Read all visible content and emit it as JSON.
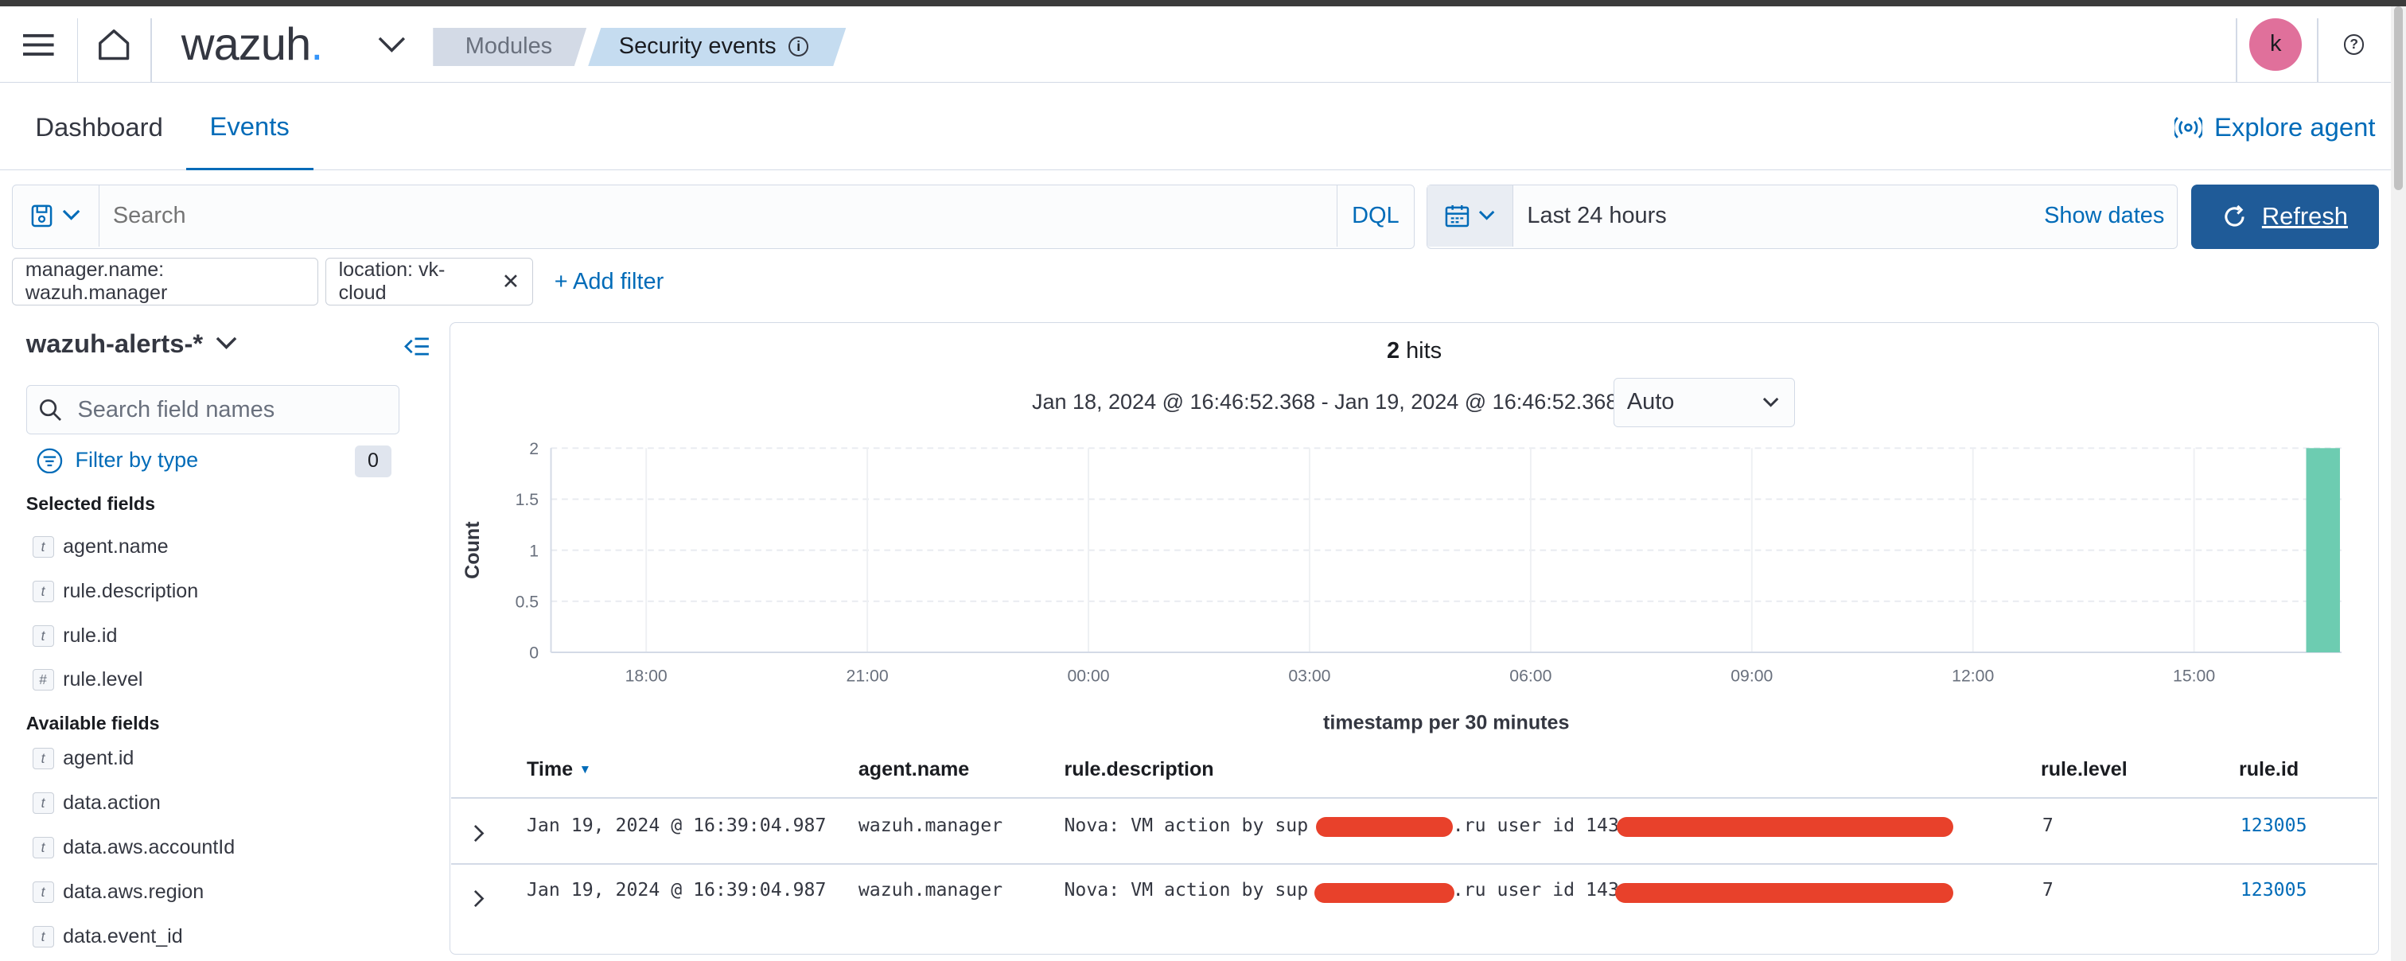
{
  "header": {
    "logo": "wazuh",
    "logo_dot": ".",
    "breadcrumbs": [
      "Modules",
      "Security events"
    ],
    "avatar_letter": "k",
    "icons": [
      "menu-icon",
      "home-icon",
      "chevron-down-icon",
      "info-icon",
      "help-icon"
    ]
  },
  "tabs": {
    "items": [
      "Dashboard",
      "Events"
    ],
    "active": "Events",
    "explore_agent": "Explore agent"
  },
  "query": {
    "search_placeholder": "Search",
    "dql": "DQL",
    "time_range": "Last 24 hours",
    "show_dates": "Show dates",
    "refresh": "Refresh"
  },
  "filters": {
    "pills": [
      "manager.name: wazuh.manager",
      "location: vk-cloud"
    ],
    "add_filter": "+ Add filter"
  },
  "sidebar": {
    "index_pattern": "wazuh-alerts-*",
    "search_placeholder": "Search field names",
    "filter_by_type": "Filter by type",
    "filter_count": "0",
    "selected_title": "Selected fields",
    "selected_fields": [
      {
        "type": "t",
        "name": "agent.name"
      },
      {
        "type": "t",
        "name": "rule.description"
      },
      {
        "type": "t",
        "name": "rule.id"
      },
      {
        "type": "#",
        "name": "rule.level"
      }
    ],
    "available_title": "Available fields",
    "available_fields": [
      {
        "type": "t",
        "name": "agent.id"
      },
      {
        "type": "t",
        "name": "data.action"
      },
      {
        "type": "t",
        "name": "data.aws.accountId"
      },
      {
        "type": "t",
        "name": "data.aws.region"
      },
      {
        "type": "t",
        "name": "data.event_id"
      }
    ]
  },
  "histogram": {
    "hits_count": "2",
    "hits_label": "hits",
    "range": "Jan 18, 2024 @ 16:46:52.368 - Jan 19, 2024 @ 16:46:52.368",
    "interval": "Auto"
  },
  "chart_data": {
    "type": "bar",
    "ylabel": "Count",
    "xlabel": "timestamp per 30 minutes",
    "yticks": [
      "2",
      "1.5",
      "1",
      "0.5",
      "0"
    ],
    "xticks": [
      "18:00",
      "21:00",
      "00:00",
      "03:00",
      "06:00",
      "09:00",
      "12:00",
      "15:00"
    ],
    "ylim": [
      0,
      2
    ],
    "x": [
      "16:30"
    ],
    "values": [
      2
    ],
    "bar_color": "#6dccb1"
  },
  "table": {
    "columns": [
      "Time",
      "agent.name",
      "rule.description",
      "rule.level",
      "rule.id"
    ],
    "rows": [
      {
        "time": "Jan 19, 2024 @ 16:39:04.987",
        "agent": "wazuh.manager",
        "desc_a": "Nova: VM action by sup",
        "desc_b": ".ru user id 143",
        "level": "7",
        "id": "123005"
      },
      {
        "time": "Jan 19, 2024 @ 16:39:04.987",
        "agent": "wazuh.manager",
        "desc_a": "Nova: VM action by sup",
        "desc_b": ".ru user id 143",
        "level": "7",
        "id": "123005"
      }
    ]
  },
  "colors": {
    "accent": "#006bb8",
    "refresh_bg": "#1f5b98",
    "redaction": "#e8412b"
  }
}
